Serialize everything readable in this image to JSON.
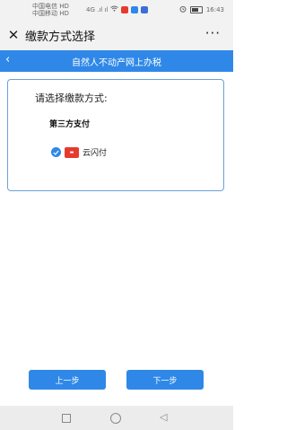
{
  "status_bar": {
    "carrier_line1": "中国电信 HD",
    "carrier_line2": "中国移动 HD",
    "signal_text": "4G .ıl ıl",
    "time": "16:43"
  },
  "title_bar": {
    "title": "缴款方式选择",
    "more_label": "···"
  },
  "banner": {
    "title": "自然人不动产网上办税"
  },
  "card": {
    "heading": "请选择缴款方式:",
    "section_title": "第三方支付",
    "option_label": "云闪付",
    "option_selected": true
  },
  "buttons": {
    "prev": "上一步",
    "next": "下一步"
  },
  "colors": {
    "primary": "#2f88e8",
    "unionpay": "#e63a2e"
  }
}
